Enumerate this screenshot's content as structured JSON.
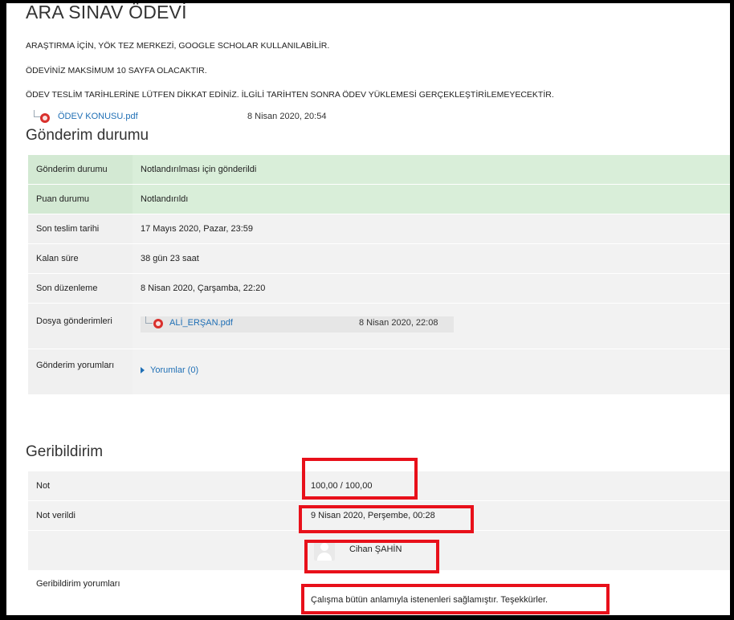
{
  "assignment": {
    "title": "ARA SINAV ÖDEVİ",
    "notes": [
      "ARAŞTIRMA İÇİN, YÖK TEZ MERKEZİ, GOOGLE SCHOLAR KULLANILABİLİR.",
      "ÖDEVİNİZ MAKSİMUM 10 SAYFA OLACAKTIR.",
      "ÖDEV TESLİM TARİHLERİNE LÜTFEN DİKKAT EDİNİZ. İLGİLİ TARİHTEN SONRA ÖDEV YÜKLEMESİ GERÇEKLEŞTİRİLEMEYECEKTİR."
    ],
    "attachment": {
      "file_name": "ÖDEV KONUSU.pdf",
      "date": "8 Nisan 2020, 20:54",
      "icon": "pdf-icon"
    }
  },
  "submission": {
    "section_title": "Gönderim durumu",
    "rows": [
      {
        "label": "Gönderim durumu",
        "value": "Notlandırılması için gönderildi"
      },
      {
        "label": "Puan durumu",
        "value": "Notlandırıldı"
      },
      {
        "label": "Son teslim tarihi",
        "value": "17 Mayıs 2020, Pazar, 23:59"
      },
      {
        "label": "Kalan süre",
        "value": "38 gün 23 saat"
      },
      {
        "label": "Son düzenleme",
        "value": "8 Nisan 2020, Çarşamba, 22:20"
      },
      {
        "label": "Dosya gönderimleri",
        "file_name": "ALİ_ERŞAN.pdf",
        "file_date": "8 Nisan 2020, 22:08"
      },
      {
        "label": "Gönderim yorumları",
        "value": "Yorumlar (0)"
      }
    ]
  },
  "feedback": {
    "section_title": "Geribildirim",
    "grade_label": "Not",
    "grade_value": "100,00 / 100,00",
    "graded_on_label": "Not verildi",
    "graded_on_value": "9 Nisan 2020, Perşembe, 00:28",
    "grader_name": "Cihan ŞAHİN",
    "comments_label": "Geribildirim yorumları",
    "comments_value": "Çalışma bütün anlamıyla istenenleri sağlamıştır. Teşekkürler."
  },
  "colors": {
    "highlight": "#e8101a",
    "status_green": "#d9eed9",
    "link": "#1f6fb5"
  }
}
